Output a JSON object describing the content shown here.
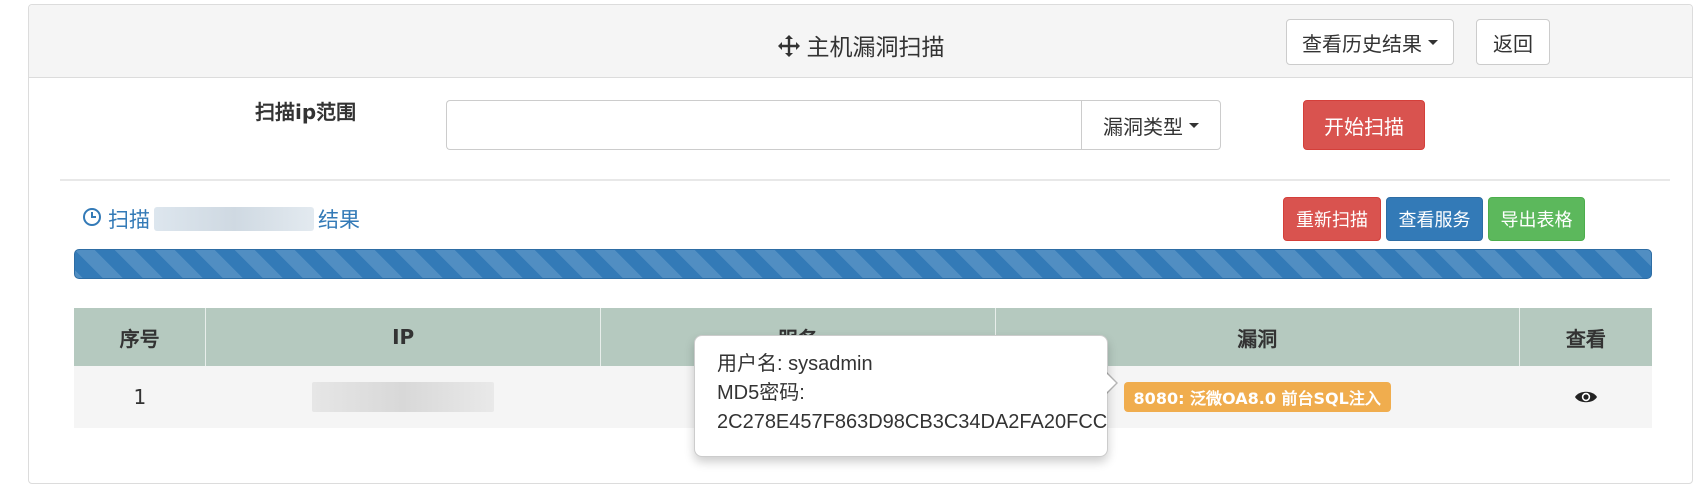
{
  "header": {
    "title": "主机漏洞扫描",
    "title_icon": "move-crosshair-icon",
    "history_label": "查看历史结果",
    "back_label": "返回"
  },
  "form": {
    "range_label": "扫描ip范围",
    "ip_value": "",
    "type_label": "漏洞类型",
    "start_label": "开始扫描"
  },
  "scan": {
    "prefix": "扫描",
    "suffix": "结果",
    "clock_icon": "clock-icon",
    "rescan_label": "重新扫描",
    "services_label": "查看服务",
    "export_label": "导出表格",
    "progress": 1.0
  },
  "table": {
    "headers": [
      "序号",
      "IP",
      "服务",
      "漏洞",
      "查看"
    ],
    "rows": [
      {
        "index": "1",
        "ip": "",
        "service": "",
        "vuln": "8080: 泛微OA8.0 前台SQL注入",
        "view_icon": "eye-icon"
      }
    ]
  },
  "popover": {
    "line1": "用户名: sysadmin",
    "line2": "MD5密码:",
    "line3": "2C278E457F863D98CB3C34DA2FA20FCC"
  },
  "colors": {
    "danger": "#d9534f",
    "primary": "#337ab7",
    "success": "#5cb85c",
    "warning": "#f0ad4e",
    "table_header": "#b5c9bf"
  }
}
